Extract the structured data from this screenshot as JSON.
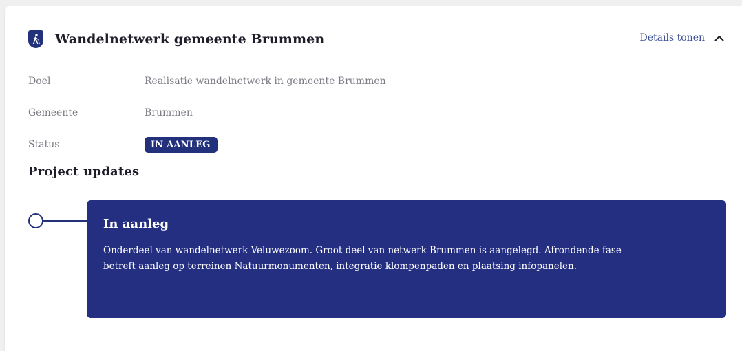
{
  "project": {
    "title": "Wandelnetwerk gemeente Brummen",
    "icon": "walking-person-icon",
    "details_toggle_label": "Details tonen",
    "fields": [
      {
        "label": "Doel",
        "value": "Realisatie wandelnetwerk in gemeente Brummen"
      },
      {
        "label": "Gemeente",
        "value": "Brummen"
      },
      {
        "label": "Status",
        "value": "IN AANLEG"
      }
    ]
  },
  "updates": {
    "section_title": "Project updates",
    "items": [
      {
        "title": "In aanleg",
        "body": "Onderdeel van wandelnetwerk Veluwezoom. Groot deel van netwerk Brummen is aangelegd. Afrondende fase betreft aanleg op terreinen Natuurmonumenten, integratie klompenpaden en plaatsing infopanelen."
      }
    ]
  },
  "colors": {
    "brand": "#23307c",
    "update_card_bg": "#252f82",
    "label_gray": "#7b7b84",
    "link": "#3d4f95",
    "background": "#f0f0f0"
  }
}
